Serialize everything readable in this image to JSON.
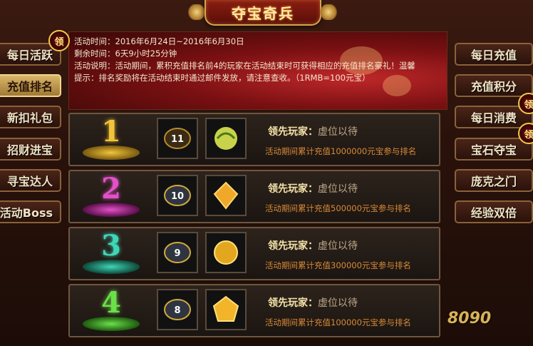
{
  "title": "夺宝奇兵",
  "info": {
    "time_label": "活动时间：",
    "time_value": "2016年6月24日~2016年6月30日",
    "remain_label": "剩余时间：",
    "remain_value": "6天9小时25分钟",
    "desc_label": "活动说明：",
    "desc_line1": "活动期间，累积充值排名前4的玩家在活动结束时可获得相应的充值排名豪礼！温馨",
    "desc_line2": "提示：排名奖励将在活动结束时通过邮件发放，请注意查收。（1RMB=100元宝）"
  },
  "badge_label": "领",
  "left_nav": [
    {
      "label": "每日活跃"
    },
    {
      "label": "充值排名",
      "active": true
    },
    {
      "label": "新扣礼包"
    },
    {
      "label": "招财进宝"
    },
    {
      "label": "寻宝达人"
    },
    {
      "label": "活动Boss"
    }
  ],
  "right_nav": [
    {
      "label": "每日充值"
    },
    {
      "label": "充值积分"
    },
    {
      "label": "每日消费"
    },
    {
      "label": "宝石夺宝"
    },
    {
      "label": "庞克之门"
    },
    {
      "label": "经验双倍"
    }
  ],
  "ranks": [
    {
      "rank": "1",
      "leader_label": "领先玩家：",
      "leader_value": "虚位以待",
      "requirement": "活动期间累计充值1000000元宝参与排名",
      "item_count": "11",
      "color": "#f2c43a"
    },
    {
      "rank": "2",
      "leader_label": "领先玩家：",
      "leader_value": "虚位以待",
      "requirement": "活动期间累计充值500000元宝参与排名",
      "item_count": "10",
      "color": "#e251c8"
    },
    {
      "rank": "3",
      "leader_label": "领先玩家：",
      "leader_value": "虚位以待",
      "requirement": "活动期间累计充值300000元宝参与排名",
      "item_count": "9",
      "color": "#3fd6b8"
    },
    {
      "rank": "4",
      "leader_label": "领先玩家：",
      "leader_value": "虚位以待",
      "requirement": "活动期间累计充值100000元宝参与排名",
      "item_count": "8",
      "color": "#6be04a"
    }
  ],
  "watermark": "8090"
}
